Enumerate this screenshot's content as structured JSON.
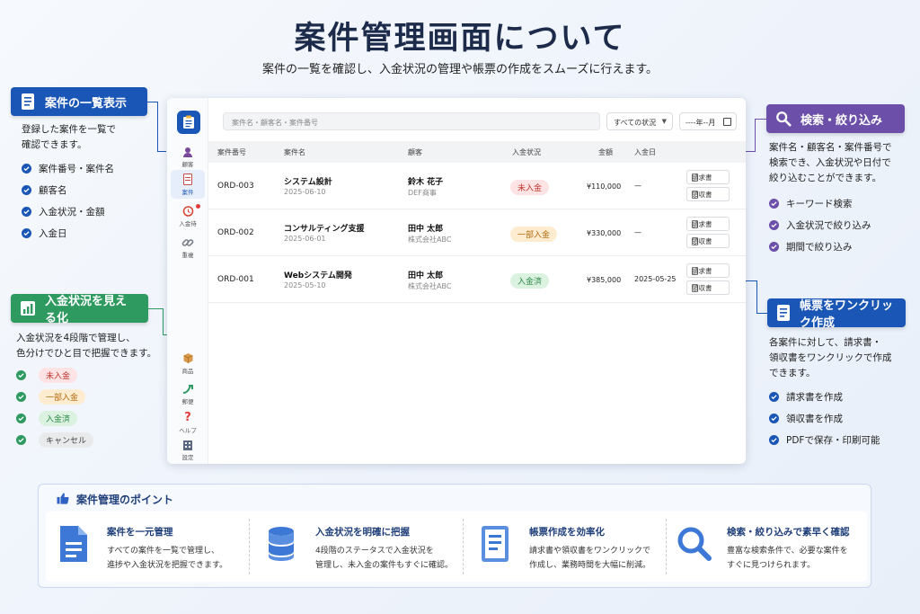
{
  "page": {
    "title": "案件管理画面について",
    "subtitle": "案件の一覧を確認し、入金状況の管理や帳票の作成をスムーズに行えます。"
  },
  "colors": {
    "blue": "#1a56b5",
    "green": "#2e9a60",
    "purple": "#6b4fa8",
    "navy": "#1d2b4a"
  },
  "annotations": {
    "list_view": {
      "tag": "案件の一覧表示",
      "icon": "document-list-icon",
      "desc": [
        "登録した案件を一覧で",
        "確認できます。"
      ],
      "bullets": [
        "案件番号・案件名",
        "顧客名",
        "入金状況・金額",
        "入金日"
      ]
    },
    "payment_status": {
      "tag": "入金状況を見える化",
      "icon": "bar-chart-icon",
      "desc": [
        "入金状況を4段階で管理し、",
        "色分けでひと目で把握できます。"
      ],
      "badges": [
        "未入金",
        "一部入金",
        "入金済",
        "キャンセル"
      ]
    },
    "search": {
      "tag": "検索・絞り込み",
      "icon": "search-icon",
      "desc": [
        "案件名・顧客名・案件番号で",
        "検索でき、入金状況や日付で",
        "絞り込むことができます。"
      ],
      "bullets": [
        "キーワード検索",
        "入金状況で絞り込み",
        "期間で絞り込み"
      ]
    },
    "one_click": {
      "tag": "帳票をワンクリック作成",
      "icon": "document-edit-icon",
      "desc": [
        "各案件に対して、請求書・",
        "領収書をワンクリックで作成",
        "できます。"
      ],
      "bullets": [
        "請求書を作成",
        "領収書を作成",
        "PDFで保存・印刷可能"
      ]
    }
  },
  "app": {
    "nav": [
      {
        "label": "顧客",
        "icon": "person-icon"
      },
      {
        "label": "案件",
        "icon": "document-icon",
        "active": true
      },
      {
        "label": "入金待",
        "icon": "alarm-clock-icon"
      },
      {
        "label": "重複",
        "icon": "link-icon"
      },
      {
        "label": "商品",
        "icon": "box-icon"
      },
      {
        "label": "郵便",
        "icon": "arrow-icon"
      },
      {
        "label": "ヘルプ",
        "icon": "question-icon"
      },
      {
        "label": "設定",
        "icon": "building-icon"
      }
    ],
    "search_placeholder": "案件名・顧客名・案件番号",
    "status_filter": "すべての状況",
    "date_filter": "----年--月",
    "columns": [
      "案件番号",
      "案件名",
      "顧客",
      "入金状況",
      "金額",
      "入金日"
    ],
    "rows": [
      {
        "id": "ORD-003",
        "name": "システム設計",
        "date": "2025-06-10",
        "customer": "鈴木 花子",
        "company": "DEF商事",
        "status": "未入金",
        "status_color": "red",
        "amount": "¥110,000",
        "paid_date": "—"
      },
      {
        "id": "ORD-002",
        "name": "コンサルティング支援",
        "date": "2025-06-01",
        "customer": "田中 太郎",
        "company": "株式会社ABC",
        "status": "一部入金",
        "status_color": "orange",
        "amount": "¥330,000",
        "paid_date": "—"
      },
      {
        "id": "ORD-001",
        "name": "Webシステム開発",
        "date": "2025-05-10",
        "customer": "田中 太郎",
        "company": "株式会社ABC",
        "status": "入金済",
        "status_color": "green",
        "amount": "¥385,000",
        "paid_date": "2025-05-25"
      }
    ],
    "invoice_btn": "請求書",
    "receipt_btn": "領収書"
  },
  "points": {
    "title": "案件管理のポイント",
    "items": [
      {
        "title": "案件を一元管理",
        "desc": [
          "すべての案件を一覧で管理し、",
          "進捗や入金状況を把握できます。"
        ],
        "icon": "document-icon"
      },
      {
        "title": "入金状況を明確に把握",
        "desc": [
          "4段階のステータスで入金状況を",
          "管理し、未入金の案件もすぐに確認。"
        ],
        "icon": "database-icon"
      },
      {
        "title": "帳票作成を効率化",
        "desc": [
          "請求書や領収書をワンクリックで",
          "作成し、業務時間を大幅に削減。"
        ],
        "icon": "form-icon"
      },
      {
        "title": "検索・絞り込みで素早く確認",
        "desc": [
          "豊富な検索条件で、必要な案件を",
          "すぐに見つけられます。"
        ],
        "icon": "search-icon"
      }
    ]
  }
}
